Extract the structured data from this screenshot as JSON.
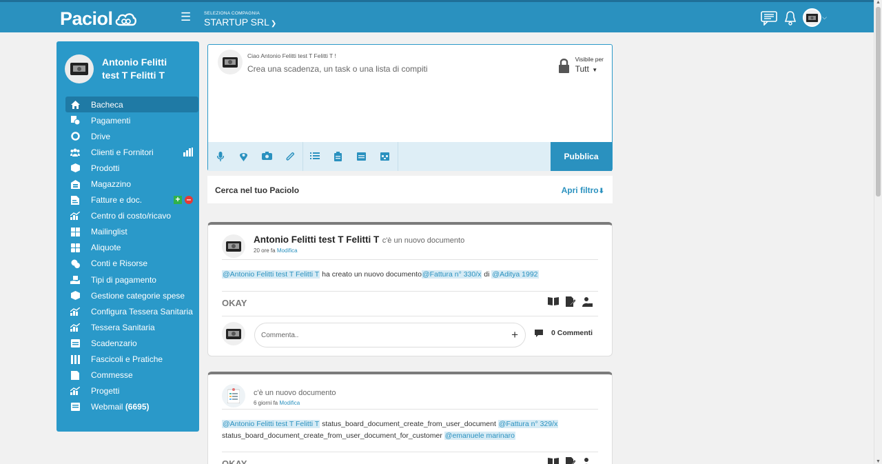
{
  "app": {
    "logo_text": "Paciol",
    "company_label": "SELEZIONA COMPAGNIA",
    "company_name": "STARTUP SRL"
  },
  "sidebar": {
    "user_name": "Antonio Felitti test T Felitti T",
    "items": [
      {
        "label": "Bacheca",
        "icon": "home-icon"
      },
      {
        "label": "Pagamenti",
        "icon": "payments-icon"
      },
      {
        "label": "Drive",
        "icon": "drive-icon"
      },
      {
        "label": "Clienti e Fornitori",
        "icon": "users-icon"
      },
      {
        "label": "Prodotti",
        "icon": "box-icon"
      },
      {
        "label": "Magazzino",
        "icon": "warehouse-icon"
      },
      {
        "label": "Fatture e doc.",
        "icon": "invoice-icon"
      },
      {
        "label": "Centro di costo/ricavo",
        "icon": "chart-icon"
      },
      {
        "label": "Mailinglist",
        "icon": "mailinglist-icon"
      },
      {
        "label": "Aliquote",
        "icon": "grid-icon"
      },
      {
        "label": "Conti e Risorse",
        "icon": "coins-icon"
      },
      {
        "label": "Tipi di pagamento",
        "icon": "hand-money-icon"
      },
      {
        "label": "Gestione categorie spese",
        "icon": "box-icon"
      },
      {
        "label": "Configura Tessera Sanitaria",
        "icon": "chart-icon"
      },
      {
        "label": "Tessera Sanitaria",
        "icon": "chart-icon"
      },
      {
        "label": "Scadenzario",
        "icon": "calendar-icon"
      },
      {
        "label": "Fascicoli e Pratiche",
        "icon": "folders-icon"
      },
      {
        "label": "Commesse",
        "icon": "document-icon"
      },
      {
        "label": "Progetti",
        "icon": "chart-icon"
      },
      {
        "label": "Webmail",
        "icon": "mail-icon",
        "count": "(6695)"
      }
    ]
  },
  "compose": {
    "greeting": "Ciao Antonio Felitti test T Felitti T !",
    "placeholder": "Crea una scadenza, un task o una lista di compiti",
    "visibility_label": "Visibile per",
    "visibility_value": "Tutt",
    "publish_label": "Pubblica"
  },
  "search": {
    "label": "Cerca nel tuo Paciolo",
    "filter_label": "Apri filtro"
  },
  "posts": [
    {
      "author": "Antonio Felitti test T Felitti T",
      "action": "c'è un nuovo documento",
      "time": "20 ore fa",
      "edit": "Modifica",
      "mention_user": "@Antonio Felitti test T Felitti T",
      "text1": " ha creato un nuovo documento",
      "mention_doc": "@Fattura n° 330/x",
      "text2": " di ",
      "mention_customer": "@Aditya 1992",
      "status": "OKAY",
      "comment_placeholder": "Commenta..",
      "comments_count": "0 Commenti"
    },
    {
      "action": "c'è un nuovo documento",
      "time": "6 giorni fa",
      "edit": "Modifica",
      "mention_user": "@Antonio Felitti test T Felitti T",
      "text1": " status_board_document_create_from_user_document ",
      "mention_doc": "@Fattura n° 329/x",
      "text2": "status_board_document_create_from_user_document_for_customer ",
      "mention_customer": "@emanuele marinaro",
      "status": "OKAY"
    }
  ]
}
